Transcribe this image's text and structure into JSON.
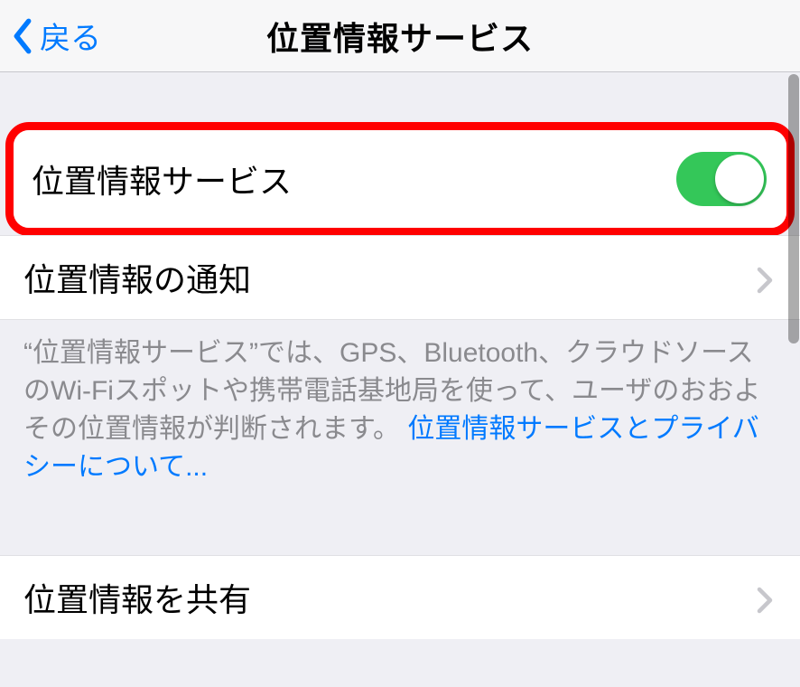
{
  "header": {
    "back_label": "戻る",
    "title": "位置情報サービス"
  },
  "rows": {
    "location_services": {
      "label": "位置情報サービス",
      "toggle_on": true
    },
    "location_alerts": {
      "label": "位置情報の通知"
    },
    "share_location": {
      "label": "位置情報を共有"
    }
  },
  "description": {
    "text": "“位置情報サービス”では、GPS、Bluetooth、クラウドソースのWi-Fiスポットや携帯電話基地局を使って、ユーザのおおよその位置情報が判断されます。 ",
    "link": "位置情報サービスとプライバシーについて..."
  },
  "colors": {
    "accent": "#007aff",
    "toggle_on": "#34c759",
    "highlight_border": "#ff0000"
  }
}
